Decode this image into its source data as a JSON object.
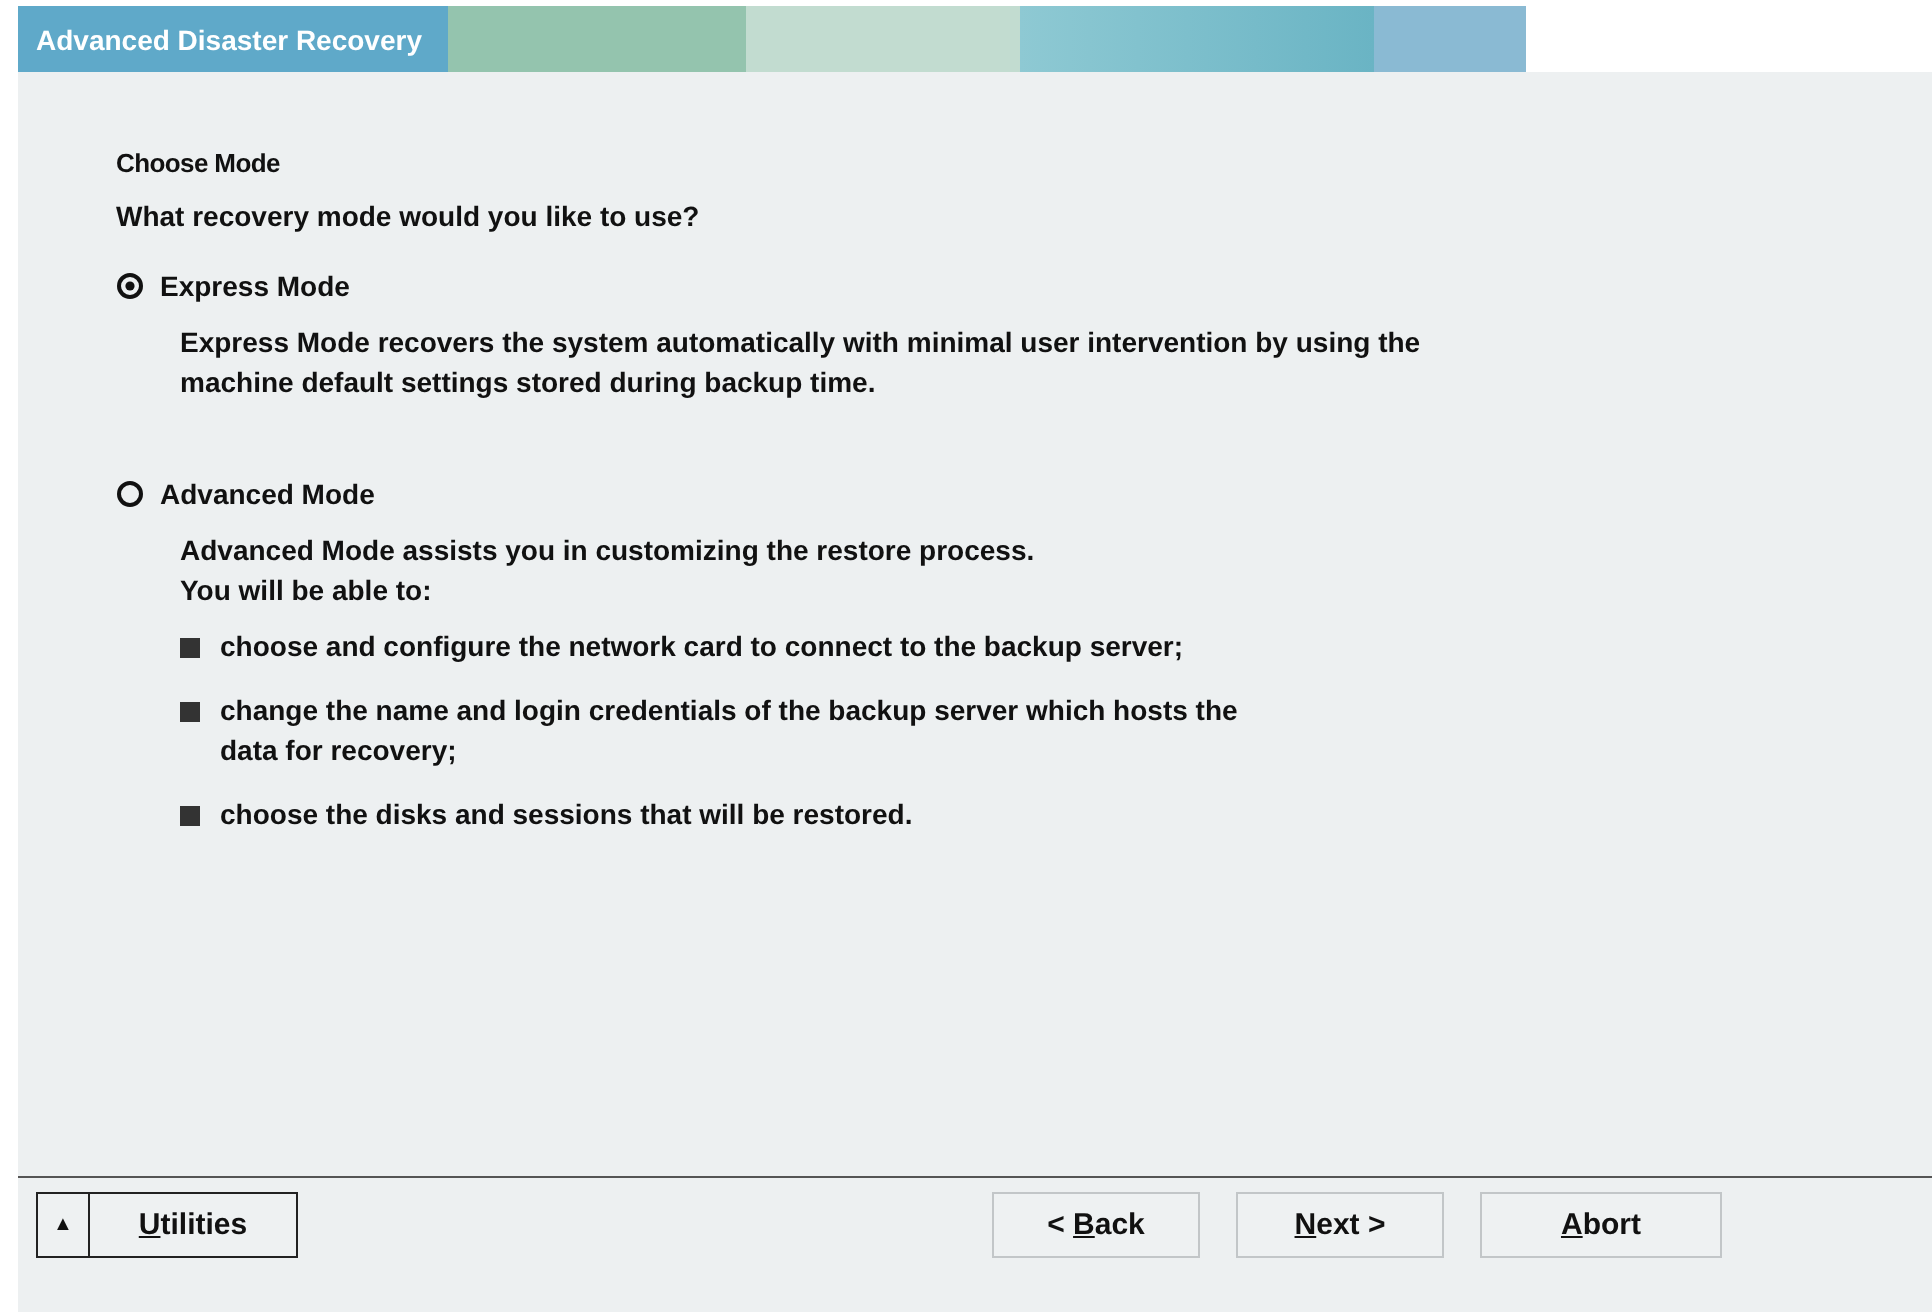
{
  "window": {
    "title": "Advanced Disaster Recovery"
  },
  "page": {
    "heading": "Choose Mode",
    "question": "What recovery mode would you like to use?"
  },
  "modes": [
    {
      "label": "Express Mode",
      "selected": true,
      "description": [
        "Express Mode recovers the system automatically with minimal user intervention by using the",
        "machine default settings stored during backup time."
      ]
    },
    {
      "label": "Advanced Mode",
      "selected": false,
      "description": [
        "Advanced Mode assists you in customizing the restore process.",
        "You will be able to:"
      ],
      "points": [
        [
          "choose and configure the network card to connect to the backup server;"
        ],
        [
          "change the name and login credentials of the backup server which hosts the",
          "data for recovery;"
        ],
        [
          "choose the disks and sessions that will be restored."
        ]
      ]
    }
  ],
  "utilities": {
    "toggle": "▲",
    "accel": "U",
    "rest": "tilities"
  },
  "buttons": [
    {
      "before": "< ",
      "accel": "B",
      "after": "ack"
    },
    {
      "accel": "N",
      "after": "ext >"
    },
    {
      "accel": "A",
      "after": "bort"
    }
  ]
}
